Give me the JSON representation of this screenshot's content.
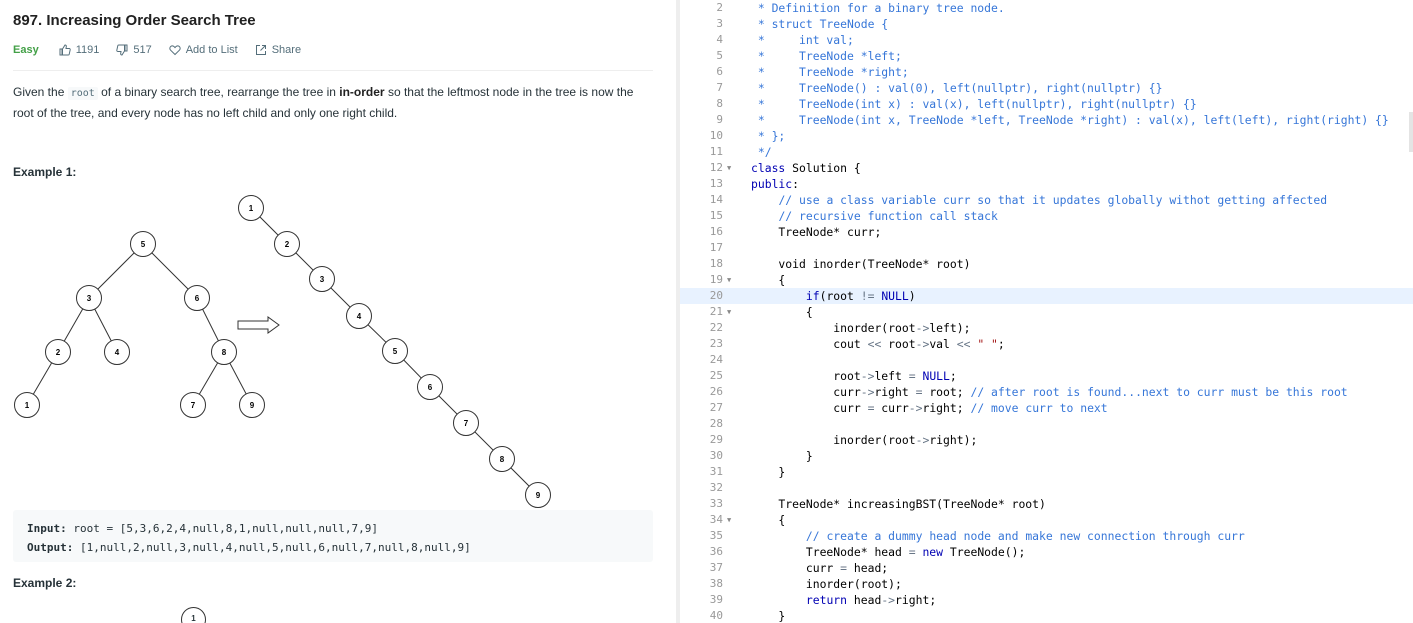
{
  "problem": {
    "title": "897. Increasing Order Search Tree",
    "difficulty": "Easy",
    "likes": "1191",
    "dislikes": "517",
    "add_to_list": "Add to List",
    "share": "Share",
    "desc_1": "Given the ",
    "desc_code": "root",
    "desc_2": " of a binary search tree, rearrange the tree in ",
    "desc_bold": "in-order",
    "desc_3": " so that the leftmost node in the tree is now the root of the tree, and every node has no left child and only one right child.",
    "example1_heading": "Example 1:",
    "example2_heading": "Example 2:",
    "input_label": "Input:",
    "input_value": " root = [5,3,6,2,4,null,8,1,null,null,null,7,9]",
    "output_label": "Output:",
    "output_value": " [1,null,2,null,3,null,4,null,5,null,6,null,7,null,8,null,9]",
    "example2_root": "1"
  },
  "trees": {
    "input_nodes": [
      "5",
      "3",
      "6",
      "2",
      "4",
      "8",
      "1",
      "7",
      "9"
    ],
    "output_nodes": [
      "1",
      "2",
      "3",
      "4",
      "5",
      "6",
      "7",
      "8",
      "9"
    ]
  },
  "editor": {
    "active_line": 20,
    "lines": [
      {
        "n": 2,
        "fold": "",
        "segs": [
          [
            "c",
            " * Definition for a binary tree node."
          ]
        ]
      },
      {
        "n": 3,
        "fold": "",
        "segs": [
          [
            "c",
            " * struct TreeNode {"
          ]
        ]
      },
      {
        "n": 4,
        "fold": "",
        "segs": [
          [
            "c",
            " *     int val;"
          ]
        ]
      },
      {
        "n": 5,
        "fold": "",
        "segs": [
          [
            "c",
            " *     TreeNode *left;"
          ]
        ]
      },
      {
        "n": 6,
        "fold": "",
        "segs": [
          [
            "c",
            " *     TreeNode *right;"
          ]
        ]
      },
      {
        "n": 7,
        "fold": "",
        "segs": [
          [
            "c",
            " *     TreeNode() : val(0), left(nullptr), right(nullptr) {}"
          ]
        ]
      },
      {
        "n": 8,
        "fold": "",
        "segs": [
          [
            "c",
            " *     TreeNode(int x) : val(x), left(nullptr), right(nullptr) {}"
          ]
        ]
      },
      {
        "n": 9,
        "fold": "",
        "segs": [
          [
            "c",
            " *     TreeNode(int x, TreeNode *left, TreeNode *right) : val(x), left(left), right(right) {}"
          ]
        ]
      },
      {
        "n": 10,
        "fold": "",
        "segs": [
          [
            "c",
            " * };"
          ]
        ]
      },
      {
        "n": 11,
        "fold": "",
        "segs": [
          [
            "c",
            " */"
          ]
        ]
      },
      {
        "n": 12,
        "fold": "▼",
        "segs": [
          [
            "k",
            "class"
          ],
          [
            "t",
            " Solution {"
          ]
        ]
      },
      {
        "n": 13,
        "fold": "",
        "segs": [
          [
            "k",
            "public"
          ],
          [
            "t",
            ":"
          ]
        ]
      },
      {
        "n": 14,
        "fold": "",
        "segs": [
          [
            "t",
            "    "
          ],
          [
            "c",
            "// use a class variable curr so that it updates globally withot getting affected"
          ]
        ]
      },
      {
        "n": 15,
        "fold": "",
        "segs": [
          [
            "t",
            "    "
          ],
          [
            "c",
            "// recursive function call stack"
          ]
        ]
      },
      {
        "n": 16,
        "fold": "",
        "segs": [
          [
            "t",
            "    TreeNode* curr;"
          ]
        ]
      },
      {
        "n": 17,
        "fold": "",
        "segs": [
          [
            "t",
            ""
          ]
        ]
      },
      {
        "n": 18,
        "fold": "",
        "segs": [
          [
            "t",
            "    void inorder(TreeNode* root)"
          ]
        ]
      },
      {
        "n": 19,
        "fold": "▼",
        "segs": [
          [
            "t",
            "    {"
          ]
        ]
      },
      {
        "n": 20,
        "fold": "",
        "segs": [
          [
            "t",
            "        "
          ],
          [
            "k",
            "if"
          ],
          [
            "t",
            "(root "
          ],
          [
            "o",
            "!="
          ],
          [
            "t",
            " "
          ],
          [
            "k",
            "NULL"
          ],
          [
            "t",
            ")"
          ]
        ]
      },
      {
        "n": 21,
        "fold": "▼",
        "segs": [
          [
            "t",
            "        {"
          ]
        ]
      },
      {
        "n": 22,
        "fold": "",
        "segs": [
          [
            "t",
            "            inorder(root"
          ],
          [
            "o",
            "->"
          ],
          [
            "t",
            "left);"
          ]
        ]
      },
      {
        "n": 23,
        "fold": "",
        "segs": [
          [
            "t",
            "            cout "
          ],
          [
            "o",
            "<<"
          ],
          [
            "t",
            " root"
          ],
          [
            "o",
            "->"
          ],
          [
            "t",
            "val "
          ],
          [
            "o",
            "<<"
          ],
          [
            "t",
            " "
          ],
          [
            "s",
            "\" \""
          ],
          [
            "t",
            ";"
          ]
        ]
      },
      {
        "n": 24,
        "fold": "",
        "segs": [
          [
            "t",
            ""
          ]
        ]
      },
      {
        "n": 25,
        "fold": "",
        "segs": [
          [
            "t",
            "            root"
          ],
          [
            "o",
            "->"
          ],
          [
            "t",
            "left "
          ],
          [
            "o",
            "="
          ],
          [
            "t",
            " "
          ],
          [
            "k",
            "NULL"
          ],
          [
            "t",
            ";"
          ]
        ]
      },
      {
        "n": 26,
        "fold": "",
        "segs": [
          [
            "t",
            "            curr"
          ],
          [
            "o",
            "->"
          ],
          [
            "t",
            "right "
          ],
          [
            "o",
            "="
          ],
          [
            "t",
            " root; "
          ],
          [
            "c",
            "// after root is found...next to curr must be this root"
          ]
        ]
      },
      {
        "n": 27,
        "fold": "",
        "segs": [
          [
            "t",
            "            curr "
          ],
          [
            "o",
            "="
          ],
          [
            "t",
            " curr"
          ],
          [
            "o",
            "->"
          ],
          [
            "t",
            "right; "
          ],
          [
            "c",
            "// move curr to next"
          ]
        ]
      },
      {
        "n": 28,
        "fold": "",
        "segs": [
          [
            "t",
            ""
          ]
        ]
      },
      {
        "n": 29,
        "fold": "",
        "segs": [
          [
            "t",
            "            inorder(root"
          ],
          [
            "o",
            "->"
          ],
          [
            "t",
            "right);"
          ]
        ]
      },
      {
        "n": 30,
        "fold": "",
        "segs": [
          [
            "t",
            "        }"
          ]
        ]
      },
      {
        "n": 31,
        "fold": "",
        "segs": [
          [
            "t",
            "    }"
          ]
        ]
      },
      {
        "n": 32,
        "fold": "",
        "segs": [
          [
            "t",
            ""
          ]
        ]
      },
      {
        "n": 33,
        "fold": "",
        "segs": [
          [
            "t",
            "    TreeNode* increasingBST(TreeNode* root)"
          ]
        ]
      },
      {
        "n": 34,
        "fold": "▼",
        "segs": [
          [
            "t",
            "    {"
          ]
        ]
      },
      {
        "n": 35,
        "fold": "",
        "segs": [
          [
            "t",
            "        "
          ],
          [
            "c",
            "// create a dummy head node and make new connection through curr"
          ]
        ]
      },
      {
        "n": 36,
        "fold": "",
        "segs": [
          [
            "t",
            "        TreeNode* head "
          ],
          [
            "o",
            "="
          ],
          [
            "t",
            " "
          ],
          [
            "k",
            "new"
          ],
          [
            "t",
            " TreeNode();"
          ]
        ]
      },
      {
        "n": 37,
        "fold": "",
        "segs": [
          [
            "t",
            "        curr "
          ],
          [
            "o",
            "="
          ],
          [
            "t",
            " head;"
          ]
        ]
      },
      {
        "n": 38,
        "fold": "",
        "segs": [
          [
            "t",
            "        inorder(root);"
          ]
        ]
      },
      {
        "n": 39,
        "fold": "",
        "segs": [
          [
            "t",
            "        "
          ],
          [
            "k",
            "return"
          ],
          [
            "t",
            " head"
          ],
          [
            "o",
            "->"
          ],
          [
            "t",
            "right;"
          ]
        ]
      },
      {
        "n": 40,
        "fold": "",
        "segs": [
          [
            "t",
            "    }"
          ]
        ]
      }
    ]
  }
}
